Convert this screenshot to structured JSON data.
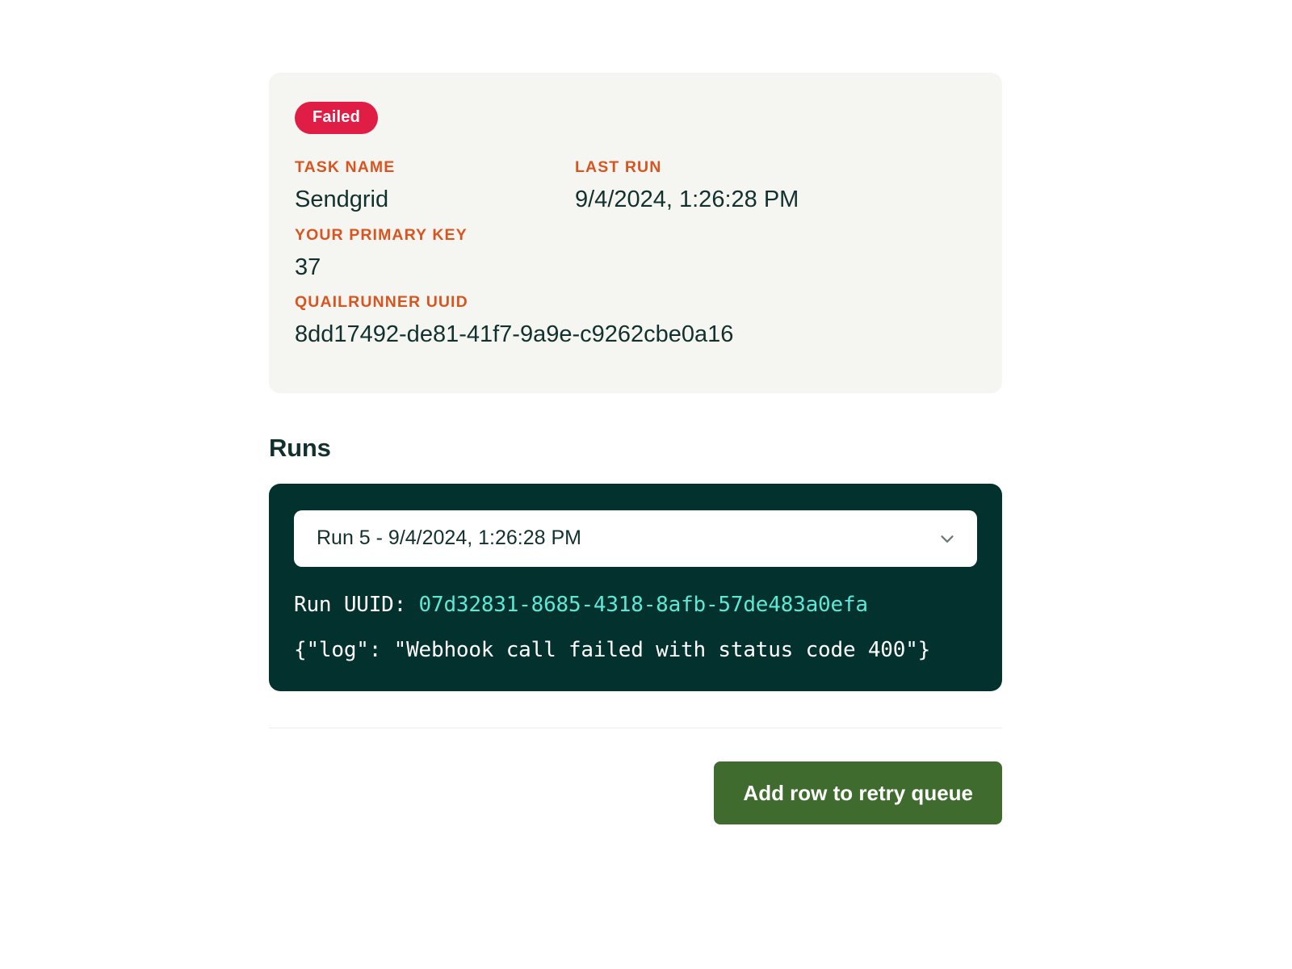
{
  "summary": {
    "status_badge": "Failed",
    "fields": [
      {
        "label": "TASK NAME",
        "value": "Sendgrid"
      },
      {
        "label": "LAST RUN",
        "value": "9/4/2024, 1:26:28 PM"
      },
      {
        "label": "YOUR PRIMARY KEY",
        "value": "37"
      },
      {
        "label": "QUAILRUNNER UUID",
        "value": "8dd17492-de81-41f7-9a9e-c9262cbe0a16"
      }
    ]
  },
  "runs": {
    "section_title": "Runs",
    "selected_run": "Run 5 - 9/4/2024, 1:26:28 PM",
    "chevron_icon": "chevron-down-icon",
    "run_uuid_label": "Run UUID: ",
    "run_uuid_value": "07d32831-8685-4318-8afb-57de483a0efa",
    "log_output": "{\"log\": \"Webhook call failed with status code 400\"}"
  },
  "footer": {
    "primary_action": "Add row to retry queue"
  },
  "colors": {
    "status_failed": "#e01e45",
    "label_accent": "#d9541f",
    "panel_dark": "#03312e",
    "uuid_teal": "#5ee8d6",
    "button_green": "#3f6b2e",
    "card_background": "#f5f6f2",
    "text_primary": "#12312e"
  }
}
